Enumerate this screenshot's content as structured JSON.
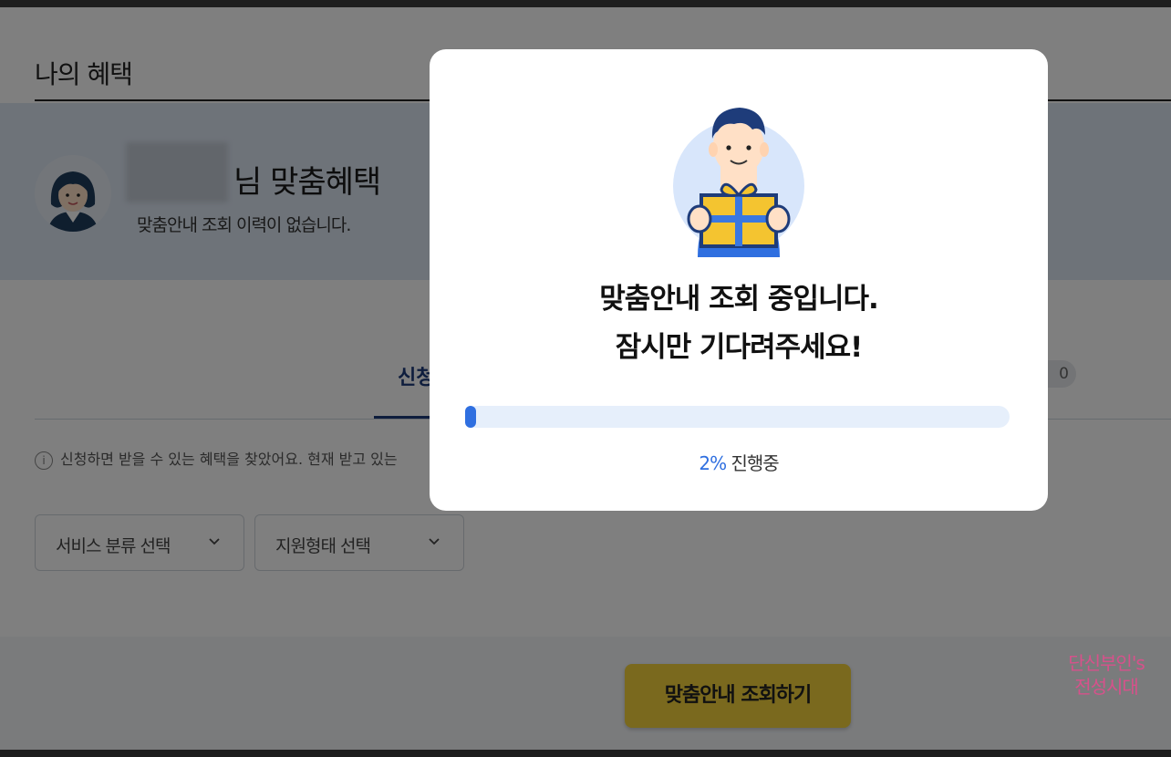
{
  "page": {
    "title": "나의 혜택",
    "banner": {
      "title": "님 맞춤혜택",
      "subtitle": "맞춤안내 조회 이력이 없습니다."
    },
    "tabs": {
      "active_label": "신청",
      "count": "0"
    },
    "info_text": "신청하면 받을 수 있는 혜택을 찾았어요. 현재 받고 있는",
    "filters": {
      "service_label": "서비스 분류 선택",
      "support_label": "지원형태 선택"
    },
    "cta_label": "맞춤안내 조회하기",
    "watermark": {
      "line1": "단신부인's",
      "line2": "전성시대"
    }
  },
  "modal": {
    "message_line1": "맞춤안내 조회 중입니다.",
    "message_line2": "잠시만 기다려주세요!",
    "progress_percent": 2,
    "progress_pct_label": "2%",
    "progress_status": "진행중"
  },
  "colors": {
    "accent": "#2f6fe0",
    "cta": "#f5d23d",
    "banner": "#dde6f3",
    "tab_active": "#1d3a7a"
  },
  "icons": {
    "avatar": "woman-avatar-icon",
    "hero": "man-holding-gift-icon",
    "info": "info-circle-icon",
    "chevron": "chevron-down-icon"
  }
}
